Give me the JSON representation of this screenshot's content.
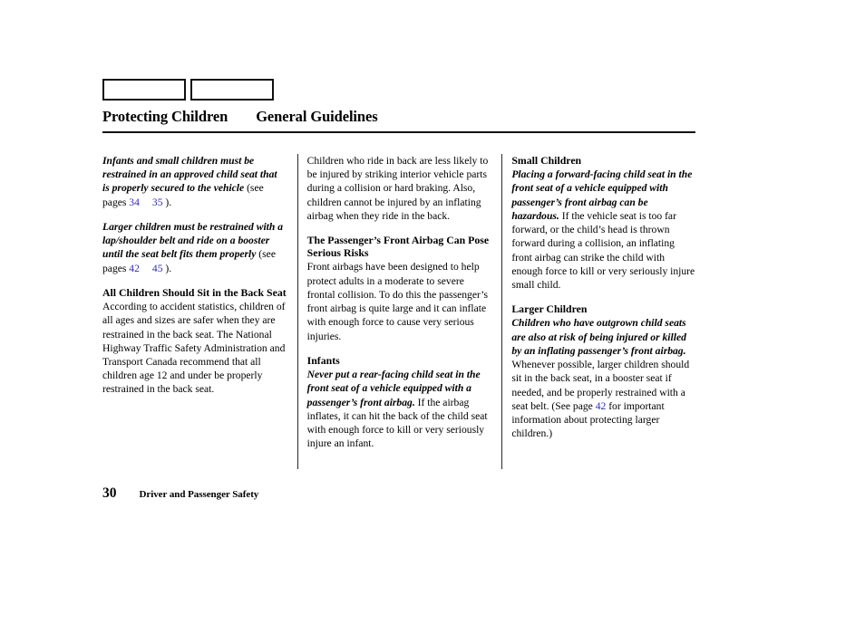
{
  "header": {
    "tab_boxes": [
      {
        "label": ""
      },
      {
        "label": ""
      }
    ],
    "title_main": "Protecting Children",
    "title_sub": "General Guidelines"
  },
  "link_color": "#2d2dc4",
  "columns": [
    {
      "name": "column-1",
      "blocks": [
        {
          "type": "paragraph",
          "lead": "Infants and small children must be restrained in an approved child seat that is properly secured to the vehicle",
          "body_before_refs": " (see pages ",
          "refs": [
            "34",
            "35"
          ],
          "body_after_refs": " )."
        },
        {
          "type": "paragraph",
          "lead": "Larger children must be restrained with a lap/shoulder belt and ride on a booster until the seat belt fits them properly",
          "body_before_refs": " (see pages ",
          "refs": [
            "42",
            "45"
          ],
          "body_after_refs": " )."
        },
        {
          "type": "section",
          "heading": "All Children Should Sit in the Back Seat",
          "body": "According to accident statistics, children of all ages and sizes are safer when they are restrained in the back seat. The National Highway Traffic Safety Administration and Transport Canada recommend that all children age 12 and under be properly restrained in the back seat."
        }
      ]
    },
    {
      "name": "column-2",
      "blocks": [
        {
          "type": "continuation",
          "body": "Children who ride in back are less likely to be injured by striking interior vehicle parts during a collision or hard braking. Also, children cannot be injured by an inflating airbag when they ride in the back."
        },
        {
          "type": "section",
          "heading": "The Passenger’s Front Airbag Can Pose Serious Risks",
          "body": "Front airbags have been designed to help protect adults in a moderate to severe frontal collision. To do this the passenger’s front airbag is quite large and it can inflate with enough force to cause very serious injuries."
        },
        {
          "type": "section",
          "heading": "Infants",
          "lead": "Never put a rear-facing child seat in the front seat of a vehicle equipped with a passenger’s front airbag.",
          "body": " If the airbag inflates, it can hit the back of the child seat with enough force to kill or very seriously injure an infant."
        }
      ]
    },
    {
      "name": "column-3",
      "blocks": [
        {
          "type": "section",
          "heading": "Small Children",
          "lead": "Placing a forward-facing child seat in the front seat of a vehicle equipped with passenger’s front airbag can be hazardous.",
          "body": " If the vehicle seat is too far forward, or the child’s head is thrown forward during a collision, an inflating front airbag can strike the child with enough force to kill or very seriously injure small child."
        },
        {
          "type": "section",
          "heading": "Larger Children",
          "lead": "Children who have outgrown child seats are also at risk of being injured or killed by an inflating passenger’s front airbag.",
          "body_before_refs": " Whenever possible, larger children should sit in the back seat, in a booster seat if needed, and be properly restrained with a seat belt. (See page ",
          "refs": [
            "42"
          ],
          "body_after_refs": " for important information about protecting larger children.)"
        }
      ]
    }
  ],
  "footer": {
    "page_number": "30",
    "section_title": "Driver and Passenger Safety"
  }
}
